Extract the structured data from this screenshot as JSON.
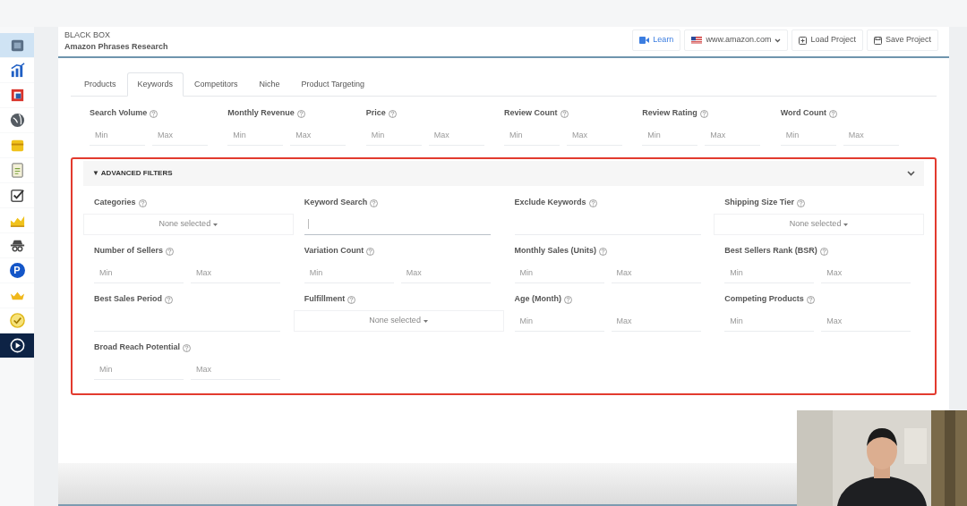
{
  "sidebar": {
    "items": [
      {
        "selected": true
      },
      {
        "selected": false
      },
      {
        "selected": false
      },
      {
        "selected": false
      },
      {
        "selected": false
      },
      {
        "selected": false
      },
      {
        "selected": false
      },
      {
        "selected": false
      },
      {
        "selected": false
      },
      {
        "selected": false,
        "label": "P"
      },
      {
        "selected": false
      },
      {
        "selected": false
      },
      {
        "selected": false,
        "kind": "dark"
      }
    ]
  },
  "header": {
    "title": "BLACK BOX",
    "subtitle": "Amazon Phrases Research",
    "actions": [
      {
        "kind": "learn",
        "label": "Learn"
      },
      {
        "kind": "market",
        "label": "www.amazon.com"
      },
      {
        "kind": "load",
        "label": "Load Project"
      },
      {
        "kind": "save",
        "label": "Save Project"
      }
    ]
  },
  "tabs": [
    {
      "label": "Products",
      "selected": false
    },
    {
      "label": "Keywords",
      "selected": true
    },
    {
      "label": "Competitors",
      "selected": false
    },
    {
      "label": "Niche",
      "selected": false
    },
    {
      "label": "Product Targeting",
      "selected": false
    }
  ],
  "filters": [
    {
      "label": "Search Volume",
      "min_placeholder": "Min",
      "max_placeholder": "Max"
    },
    {
      "label": "Monthly Revenue",
      "min_placeholder": "Min",
      "max_placeholder": "Max"
    },
    {
      "label": "Price",
      "min_placeholder": "Min",
      "max_placeholder": "Max"
    },
    {
      "label": "Review Count",
      "min_placeholder": "Min",
      "max_placeholder": "Max"
    },
    {
      "label": "Review Rating",
      "min_placeholder": "Min",
      "max_placeholder": "Max"
    },
    {
      "label": "Word Count",
      "min_placeholder": "Min",
      "max_placeholder": "Max"
    }
  ],
  "advanced_filters": {
    "title": "ADVANCED FILTERS",
    "expanded": true,
    "marker": "▼",
    "items": [
      {
        "kind": "select",
        "label": "Categories",
        "value": "None selected"
      },
      {
        "kind": "text",
        "label": "Keyword Search",
        "focused": true
      },
      {
        "kind": "text",
        "label": "Exclude Keywords",
        "focused": false
      },
      {
        "kind": "select",
        "label": "Shipping Size Tier",
        "value": "None selected"
      },
      {
        "kind": "range",
        "label": "Number of Sellers",
        "min_placeholder": "Min",
        "max_placeholder": "Max"
      },
      {
        "kind": "range",
        "label": "Variation Count",
        "min_placeholder": "Min",
        "max_placeholder": "Max"
      },
      {
        "kind": "range",
        "label": "Monthly Sales (Units)",
        "min_placeholder": "Min",
        "max_placeholder": "Max"
      },
      {
        "kind": "range",
        "label": "Best Sellers Rank (BSR)",
        "min_placeholder": "Min",
        "max_placeholder": "Max"
      },
      {
        "kind": "text",
        "label": "Best Sales Period",
        "focused": false
      },
      {
        "kind": "select",
        "label": "Fulfillment",
        "value": "None selected"
      },
      {
        "kind": "range",
        "label": "Age (Month)",
        "min_placeholder": "Min",
        "max_placeholder": "Max"
      },
      {
        "kind": "range",
        "label": "Competing Products",
        "min_placeholder": "Min",
        "max_placeholder": "Max"
      },
      {
        "kind": "range",
        "label": "Broad Reach Potential",
        "min_placeholder": "Min",
        "max_placeholder": "Max"
      }
    ]
  }
}
